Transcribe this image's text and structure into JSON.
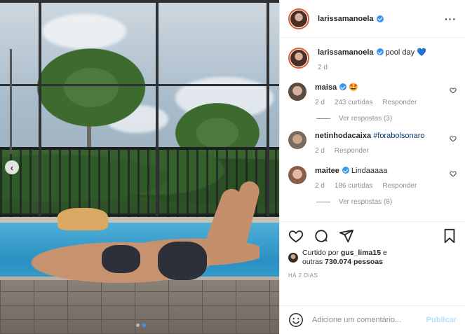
{
  "header": {
    "username": "larissamanoela",
    "more_icon": "more-horizontal-icon"
  },
  "caption": {
    "username": "larissamanoela",
    "text": "pool day",
    "emoji": "💙",
    "time": "2 d"
  },
  "comments": [
    {
      "username": "maisa",
      "verified": true,
      "text": "🤩",
      "time": "2 d",
      "likes": "243 curtidas",
      "reply_label": "Responder",
      "view_replies": "Ver respostas (3)"
    },
    {
      "username": "netinhodacaixa",
      "verified": false,
      "text": "#forabolsonaro",
      "time": "2 d",
      "likes": "",
      "reply_label": "Responder"
    },
    {
      "username": "maitee",
      "verified": true,
      "text": "Lindaaaaa",
      "time": "2 d",
      "likes": "186 curtidas",
      "reply_label": "Responder",
      "view_replies": "Ver respostas (8)"
    }
  ],
  "likes": {
    "prefix": "Curtido por",
    "user": "gus_lima15",
    "joiner": "e",
    "others_prefix": "outras",
    "count": "730.074 pessoas"
  },
  "post_time": "HÁ 2 DIAS",
  "add_comment": {
    "placeholder": "Adicione um comentário...",
    "publish_label": "Publicar"
  },
  "carousel": {
    "prev_icon": "chevron-left-icon",
    "slide_count": 2,
    "active_slide": 2
  },
  "colors": {
    "accent": "#3897f0",
    "publish_disabled": "#b2dffc",
    "muted": "#8e8e8e"
  }
}
